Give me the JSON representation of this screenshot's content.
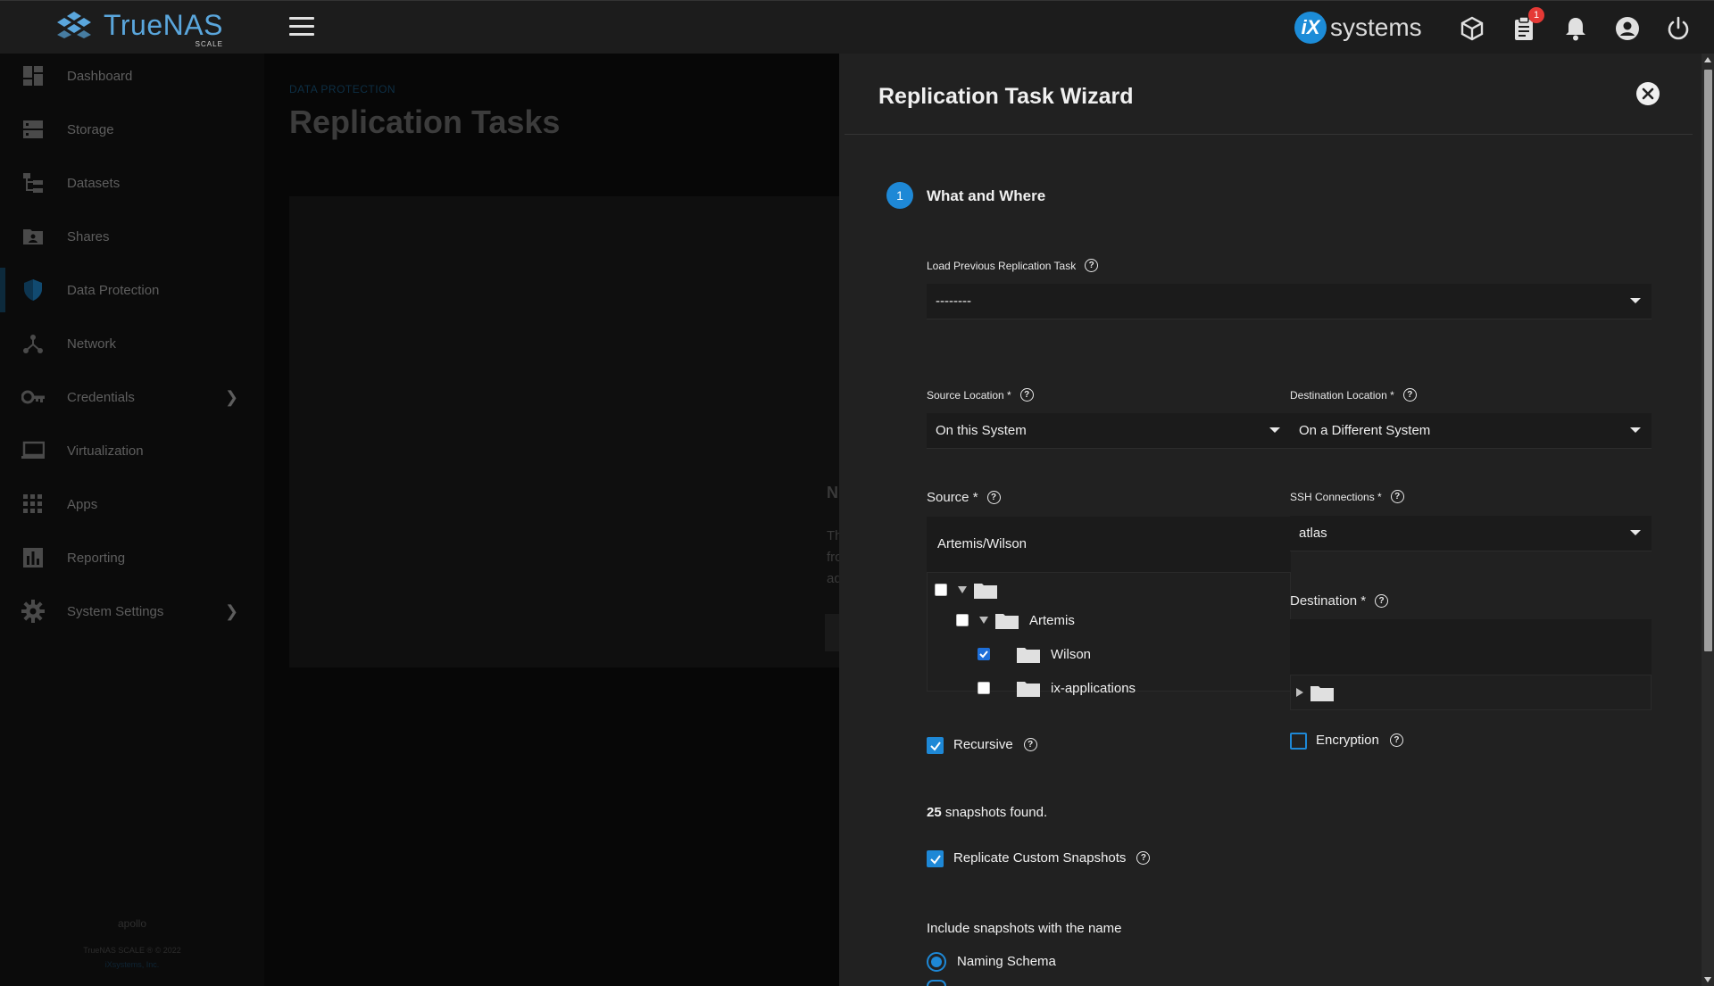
{
  "app": {
    "logo_text": "TrueNAS",
    "logo_sub": "SCALE",
    "brand_right": "systems",
    "brand_right_mark": "iX"
  },
  "header": {
    "notification_badge": "1"
  },
  "sidebar": {
    "items": [
      {
        "label": "Dashboard",
        "icon": "dashboard-icon"
      },
      {
        "label": "Storage",
        "icon": "storage-icon"
      },
      {
        "label": "Datasets",
        "icon": "datasets-icon"
      },
      {
        "label": "Shares",
        "icon": "shares-icon"
      },
      {
        "label": "Data Protection",
        "icon": "shield-icon"
      },
      {
        "label": "Network",
        "icon": "network-icon"
      },
      {
        "label": "Credentials",
        "icon": "key-icon"
      },
      {
        "label": "Virtualization",
        "icon": "laptop-icon"
      },
      {
        "label": "Apps",
        "icon": "apps-grid-icon"
      },
      {
        "label": "Reporting",
        "icon": "bar-chart-icon"
      },
      {
        "label": "System Settings",
        "icon": "gear-icon"
      }
    ],
    "hostname": "apollo",
    "copyright": "TrueNAS SCALE ® © 2022",
    "company": "iXsystems, Inc."
  },
  "main": {
    "breadcrumb": "DATA PROTECTION",
    "title": "Replication Tasks",
    "ghost_letter": "N",
    "ghost_lines": [
      "Th",
      "fro",
      "ad"
    ]
  },
  "wizard": {
    "title": "Replication Task Wizard",
    "step_number": "1",
    "step_label": "What and Where",
    "load_previous": {
      "label": "Load Previous Replication Task",
      "value": "--------"
    },
    "source_location": {
      "label": "Source Location *",
      "value": "On this System"
    },
    "destination_location": {
      "label": "Destination Location *",
      "value": "On a Different System"
    },
    "source": {
      "label": "Source *",
      "value": "Artemis/Wilson",
      "tree": [
        {
          "label": "",
          "checked": false
        },
        {
          "label": "Artemis",
          "checked": false
        },
        {
          "label": "Wilson",
          "checked": true
        },
        {
          "label": "ix-applications",
          "checked": false
        }
      ]
    },
    "ssh_connections": {
      "label": "SSH Connections *",
      "value": "atlas"
    },
    "destination": {
      "label": "Destination *",
      "value": ""
    },
    "recursive": {
      "label": "Recursive",
      "checked": true
    },
    "encryption": {
      "label": "Encryption",
      "checked": false
    },
    "snapshots_count": "25",
    "snapshots_text": " snapshots found.",
    "replicate_custom": {
      "label": "Replicate Custom Snapshots",
      "checked": true
    },
    "include_label": "Include snapshots with the name",
    "naming_schema_label": "Naming Schema"
  },
  "colors": {
    "accent": "#1e88d6",
    "drawer_bg": "#212121",
    "topbar_bg": "#1c1c1c"
  }
}
